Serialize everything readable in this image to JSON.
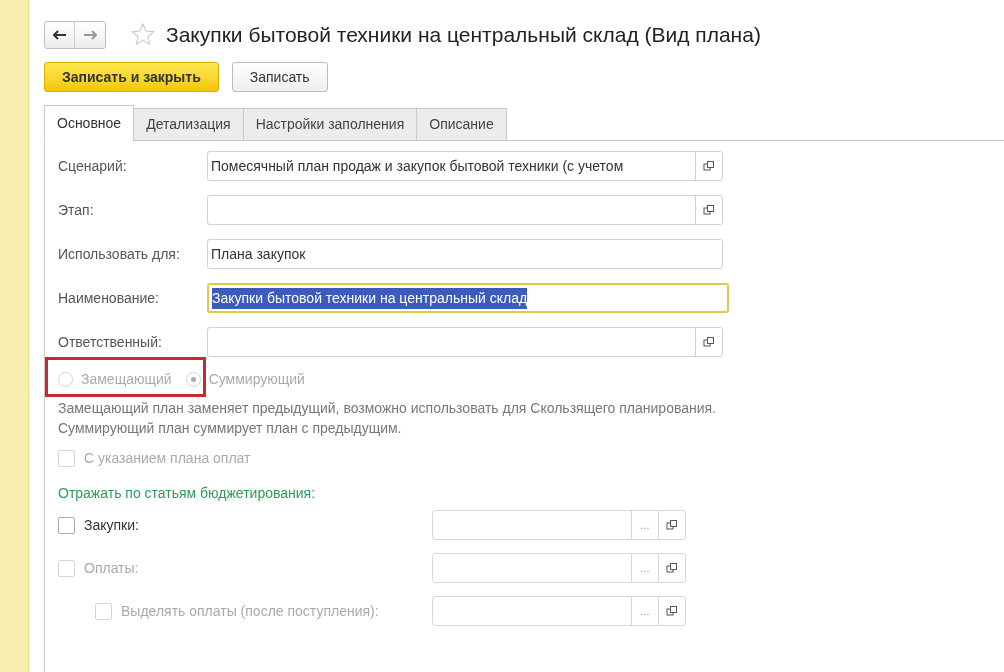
{
  "title": "Закупки бытовой техники на центральный склад (Вид плана)",
  "favorite": false,
  "buttons": [
    {
      "label": "Записать и закрыть",
      "kind": "primary"
    },
    {
      "label": "Записать",
      "kind": "normal"
    }
  ],
  "tabs": [
    {
      "label": "Основное",
      "selected": true
    },
    {
      "label": "Детализация",
      "selected": false
    },
    {
      "label": "Настройки заполнения",
      "selected": false
    },
    {
      "label": "Описание",
      "selected": false
    }
  ],
  "fields": [
    {
      "label": "Сценарий:",
      "value": "Помесячный план продаж и закупок бытовой техники (с учетом",
      "open_button": true,
      "focused": false,
      "text_selected": false
    },
    {
      "label": "Этап:",
      "open_button": true,
      "focused": false
    },
    {
      "label": "Использовать для:",
      "value": "Плана закупок",
      "open_button": false,
      "focused": false,
      "text_selected": false
    },
    {
      "label": "Наименование:",
      "value": "Закупки бытовой техники на центральный склад",
      "open_button": false,
      "focused": true,
      "text_selected": true
    },
    {
      "label": "Ответственный:",
      "open_button": true,
      "focused": false
    }
  ],
  "plan_type": {
    "disabled": true,
    "options": [
      {
        "label": "Замещающий",
        "selected": false,
        "highlighted": true
      },
      {
        "label": "Суммирующий",
        "selected": true,
        "highlighted": false
      }
    ]
  },
  "description": [
    "Замещающий план заменяет предыдущий, возможно использовать для Скользящего планирования.",
    "Суммирующий план суммирует план с предыдущим."
  ],
  "payment_plan": {
    "label": "С указанием плана оплат",
    "checked": false,
    "disabled": true
  },
  "budget_section": {
    "title": "Отражать по статьям бюджетирования:",
    "items": [
      {
        "label": "Закупки:",
        "checked": false,
        "disabled": false,
        "select_button": "..."
      },
      {
        "label": "Оплаты:",
        "checked": false,
        "disabled": true,
        "select_button": "...",
        "children": [
          {
            "label": "Выделять оплаты (после поступления):",
            "checked": false,
            "disabled": true,
            "select_button": "..."
          }
        ]
      }
    ]
  }
}
